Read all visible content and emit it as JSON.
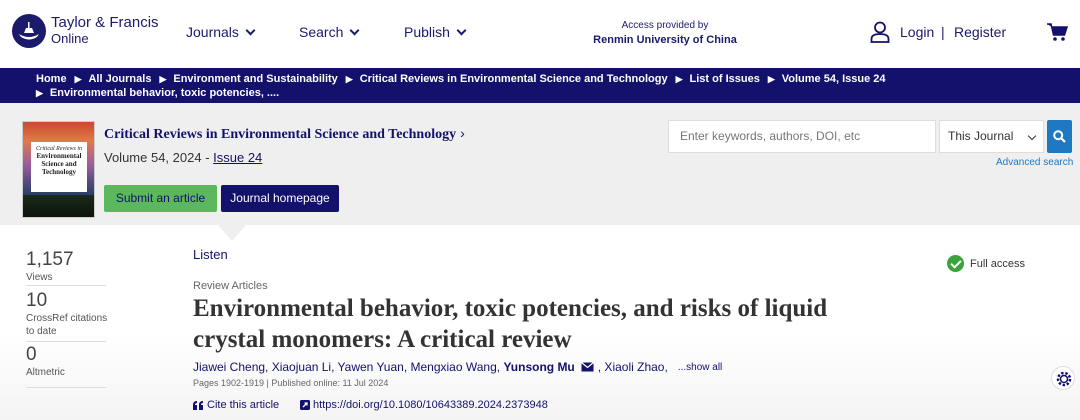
{
  "header": {
    "logo_line1": "Taylor & Francis",
    "logo_line2": "Online",
    "nav": [
      "Journals",
      "Search",
      "Publish"
    ],
    "access_label": "Access provided by",
    "access_institution": "Renmin University of China",
    "login": "Login",
    "separator": "|",
    "register": "Register"
  },
  "breadcrumb": {
    "items": [
      "Home",
      "All Journals",
      "Environment and Sustainability",
      "Critical Reviews in Environmental Science and Technology",
      "List of Issues",
      "Volume 54, Issue 24"
    ],
    "current": "Environmental behavior, toxic potencies, ...."
  },
  "journal": {
    "title": "Critical Reviews in Environmental Science and Technology",
    "volume_text": "Volume 54, 2024 - ",
    "issue_link": "Issue 24",
    "submit_label": "Submit an article",
    "homepage_label": "Journal homepage",
    "cover_text_1": "Critical Reviews in",
    "cover_text_2": "Environmental Science and Technology"
  },
  "search": {
    "placeholder": "Enter keywords, authors, DOI, etc",
    "scope": "This Journal",
    "advanced": "Advanced search"
  },
  "metrics": [
    {
      "num": "1,157",
      "label": "Views"
    },
    {
      "num": "10",
      "label": "CrossRef citations to date"
    },
    {
      "num": "0",
      "label": "Altmetric"
    }
  ],
  "article": {
    "listen": "Listen",
    "full_access": "Full access",
    "type": "Review Articles",
    "title": "Environmental behavior, toxic potencies, and risks of liquid crystal monomers: A critical review",
    "authors_before": "Jiawei Cheng, Xiaojuan Li, Yawen Yuan, Mengxiao Wang,",
    "corresponding": "Yunsong Mu",
    "authors_after": ", Xiaoli Zhao,",
    "show_all": "...show all",
    "pages_info": "Pages 1902-1919 | Published online: 11 Jul 2024",
    "cite": "Cite this article",
    "doi": "https://doi.org/10.1080/10643389.2024.2373948"
  },
  "colors": {
    "brand_navy": "#13116b",
    "submit_green": "#5cb85c",
    "search_blue": "#1e78c2",
    "access_green": "#3aa33a"
  }
}
